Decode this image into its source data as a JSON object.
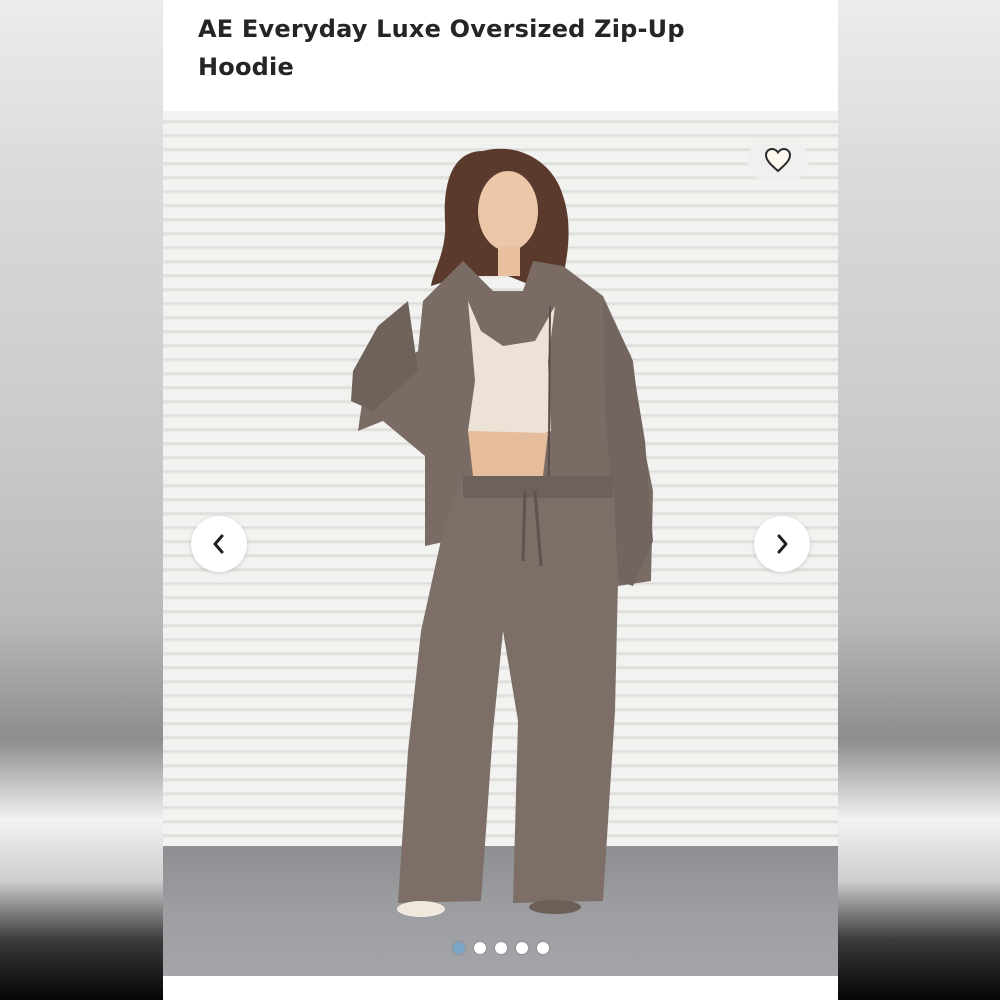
{
  "product": {
    "title": "AE Everyday Luxe Oversized Zip-Up Hoodie"
  },
  "gallery": {
    "image_count": 5,
    "active_index": 0,
    "prev_icon": "chevron-left-icon",
    "next_icon": "chevron-right-icon",
    "favorite_icon": "heart-outline-icon"
  },
  "colors": {
    "garment": "#7a6c65",
    "active_dot": "#7aa6c9"
  }
}
